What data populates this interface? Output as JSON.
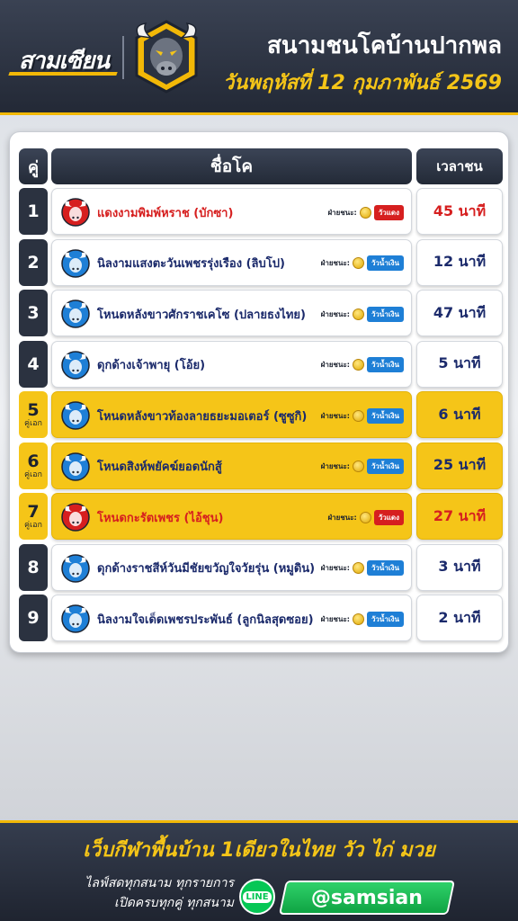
{
  "header": {
    "brand": "สามเซียน",
    "title": "สนามชนโคบ้านปากพล",
    "date": "วันพฤหัสที่ 12 กุมภาพันธ์ 2569"
  },
  "table": {
    "headers": {
      "no": "คู่",
      "name": "ชื่อโค",
      "time": "เวลาชน"
    },
    "winner_label": "ฝ่ายชนะ:",
    "rows": [
      {
        "no": "1",
        "tag": "",
        "name": "แดงงามพิมพ์หราช (บักซา)",
        "side": "วัวแดง",
        "side_color": "red",
        "time": "45 นาที",
        "featured": false
      },
      {
        "no": "2",
        "tag": "",
        "name": "นิลงามแสงตะวันเพชรรุ่งเรือง (ลิบโป)",
        "side": "วัวน้ำเงิน",
        "side_color": "blue",
        "time": "12 นาที",
        "featured": false
      },
      {
        "no": "3",
        "tag": "",
        "name": "โหนดหลังขาวศักราชเคโซ (ปลายธงไทย)",
        "side": "วัวน้ำเงิน",
        "side_color": "blue",
        "time": "47 นาที",
        "featured": false
      },
      {
        "no": "4",
        "tag": "",
        "name": "ดุกด้างเจ้าพายุ (โอ้ย)",
        "side": "วัวน้ำเงิน",
        "side_color": "blue",
        "time": "5 นาที",
        "featured": false
      },
      {
        "no": "5",
        "tag": "คู่เอก",
        "name": "โหนดหลังขาวท้องลายธยะมอเตอร์ (ซูซูกิ)",
        "side": "วัวน้ำเงิน",
        "side_color": "blue",
        "time": "6 นาที",
        "featured": true
      },
      {
        "no": "6",
        "tag": "คู่เอก",
        "name": "โหนดสิงห์พยัคฆ์ยอดนักสู้",
        "side": "วัวน้ำเงิน",
        "side_color": "blue",
        "time": "25 นาที",
        "featured": true
      },
      {
        "no": "7",
        "tag": "คู่เอก",
        "name": "โหนดกะรัตเพชร (ไอ้ชุน)",
        "side": "วัวแดง",
        "side_color": "red",
        "time": "27 นาที",
        "featured": true
      },
      {
        "no": "8",
        "tag": "",
        "name": "ดุกด้างราชสีห์วันมีชัยขวัญใจวัยรุ่น (หมูดิน)",
        "side": "วัวน้ำเงิน",
        "side_color": "blue",
        "time": "3 นาที",
        "featured": false
      },
      {
        "no": "9",
        "tag": "",
        "name": "นิลงามใจเด็ดเพชรประพันธ์ (ลูกนิลสุดซอย)",
        "side": "วัวน้ำเงิน",
        "side_color": "blue",
        "time": "2 นาที",
        "featured": false
      }
    ]
  },
  "footer": {
    "slogan": "เว็บกีฬาพื้นบ้าน 1เดียวในไทย วัว ไก่ มวย",
    "line1": "ไลฟ์สดทุกสนาม ทุกรายการ",
    "line2": "เปิดครบทุกคู่ ทุกสนาม",
    "line_badge": "LINE",
    "line_id": "@samsian"
  },
  "colors": {
    "accent": "#f5c518",
    "red_side": "#d61f1f",
    "blue_side": "#1e7fd6",
    "navy_text": "#1b2a6b",
    "dark_bg": "#2b3240"
  }
}
